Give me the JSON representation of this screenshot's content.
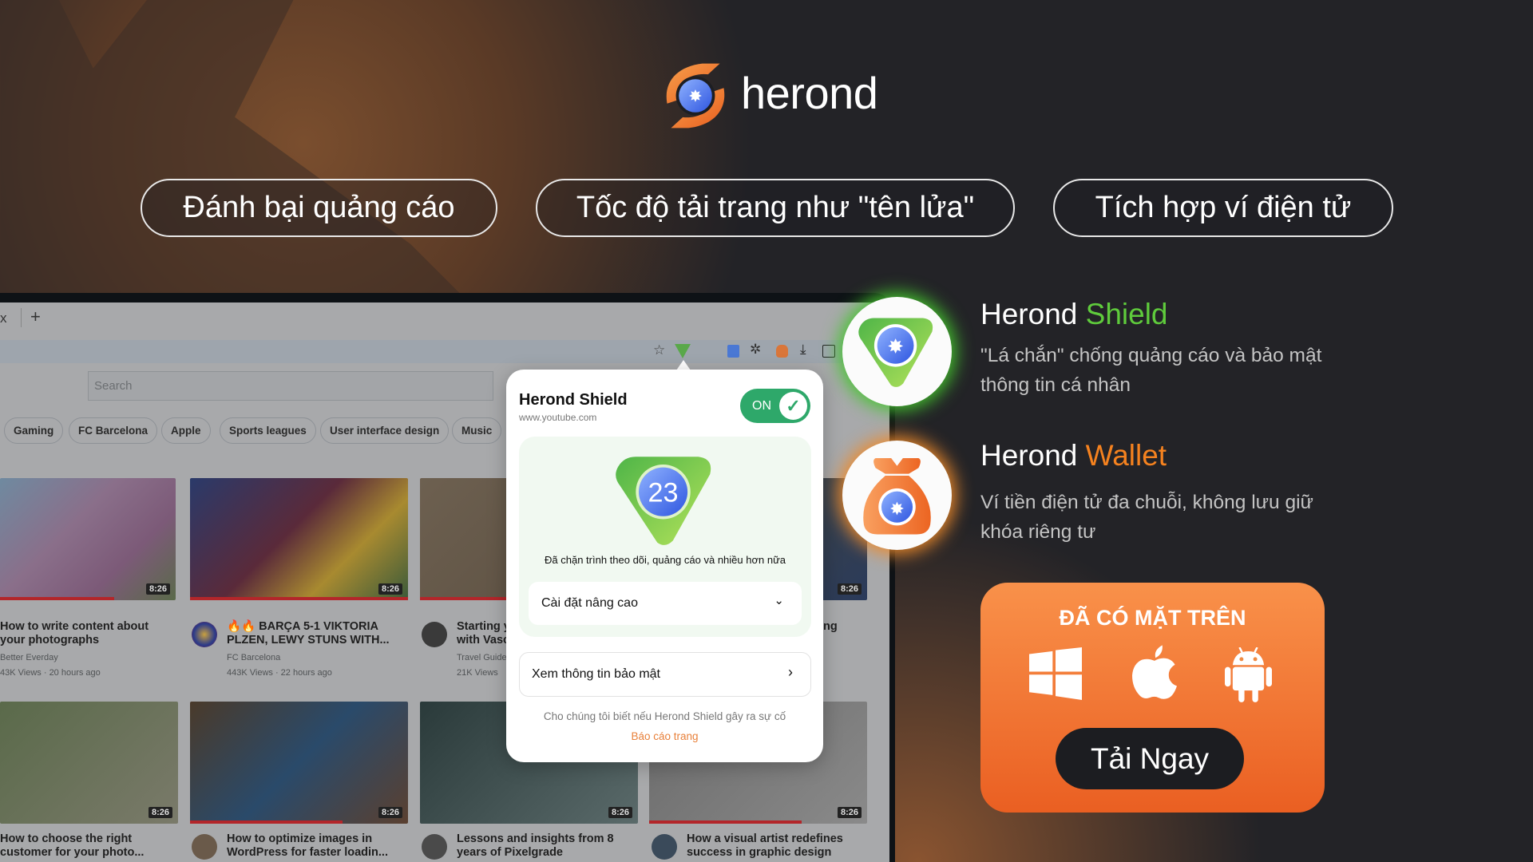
{
  "brand": {
    "name": "herond",
    "accent": "#f57c2a"
  },
  "pills": [
    "Đánh bại quảng cáo",
    "Tốc độ tải trang như \"tên lửa\"",
    "Tích hợp ví điện tử"
  ],
  "browser": {
    "tab_close": "x",
    "new_tab": "+",
    "search_placeholder": "Search",
    "toolbar_icons": [
      "star-icon",
      "herond-shield-icon",
      "translate-icon",
      "extensions-icon",
      "wallet-icon",
      "download-icon",
      "sidebar-icon"
    ],
    "chips": [
      "Gaming",
      "FC Barcelona",
      "Apple",
      "Sports leagues",
      "User interface design",
      "Music"
    ],
    "videos": [
      {
        "title": "How to write content about your photographs",
        "channel": "Better Everday",
        "views": "43K Views",
        "age": "20 hours ago",
        "duration": "8:26"
      },
      {
        "title": "🔥🔥 BARÇA 5-1 VIKTORIA PLZEN, LEWY STUNS WITH...",
        "channel": "FC Barcelona",
        "views": "443K Views",
        "age": "22 hours ago",
        "duration": "8:26"
      },
      {
        "title": "Starting y with Vasc",
        "channel": "Travel Guide",
        "views": "21K Views",
        "age": "",
        "duration": ""
      },
      {
        "title": "ng",
        "channel": "",
        "views": "",
        "age": "",
        "duration": "8:26"
      },
      {
        "title": "How to choose the right customer for your photo...",
        "duration": "8:26"
      },
      {
        "title": "How to optimize images in WordPress for faster loadin...",
        "duration": "8:26"
      },
      {
        "title": "Lessons and insights from 8 years of Pixelgrade",
        "duration": "8:26"
      },
      {
        "title": "How a visual artist redefines success in graphic design",
        "duration": "8:26"
      }
    ]
  },
  "popup": {
    "title": "Herond Shield",
    "site": "www.youtube.com",
    "toggle": {
      "label": "ON",
      "state": true,
      "color": "#2ea86a"
    },
    "blocked_count": "23",
    "blocked_text": "Đã chặn trình theo dõi, quảng cáo và nhiều hơn nữa",
    "advanced": "Cài đặt nâng cao",
    "security_info": "Xem thông tin bảo mật",
    "footer": "Cho chúng tôi biết nếu Herond Shield gây ra sự cố",
    "report": "Báo cáo trang"
  },
  "features": [
    {
      "prefix": "Herond",
      "highlight": "Shield",
      "color": "#5fcb3c",
      "desc": "\"Lá chắn\" chống quảng cáo và bảo mật thông tin cá nhân"
    },
    {
      "prefix": "Herond",
      "highlight": "Wallet",
      "color": "#f5821f",
      "desc": "Ví tiền điện tử đa chuỗi, không lưu giữ khóa riêng tư"
    }
  ],
  "download": {
    "heading": "ĐÃ CÓ MẶT TRÊN",
    "platforms": [
      "windows-icon",
      "apple-icon",
      "android-icon"
    ],
    "button": "Tải Ngay"
  }
}
